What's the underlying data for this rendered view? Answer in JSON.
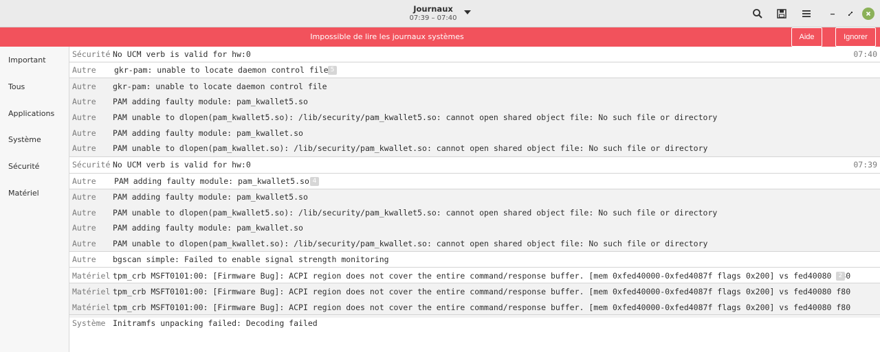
{
  "header": {
    "title": "Journaux",
    "subtitle": "07:39 – 07:40",
    "icons": [
      "search-icon",
      "save-icon",
      "menu-icon",
      "minimize-icon",
      "restore-icon",
      "close-icon"
    ]
  },
  "infobar": {
    "message": "Impossible de lire les journaux systèmes",
    "help_label": "Aide",
    "ignore_label": "Ignorer",
    "color": "#f2525c"
  },
  "sidebar": {
    "items": [
      {
        "label": "Important"
      },
      {
        "label": "Tous"
      },
      {
        "label": "Applications"
      },
      {
        "label": "Système"
      },
      {
        "label": "Sécurité"
      },
      {
        "label": "Matériel"
      }
    ]
  },
  "logs": [
    {
      "category": "Sécurité",
      "message": "No UCM verb is valid for hw:0",
      "time": "07:40"
    },
    {
      "category": "Autre",
      "message": "gkr-pam: unable to locate daemon control file",
      "count": "5"
    },
    {
      "category": "Autre",
      "message": "gkr-pam: unable to locate daemon control file"
    },
    {
      "category": "Autre",
      "message": "PAM adding faulty module: pam_kwallet5.so"
    },
    {
      "category": "Autre",
      "message": "PAM unable to dlopen(pam_kwallet5.so): /lib/security/pam_kwallet5.so: cannot open shared object file: No such file or directory"
    },
    {
      "category": "Autre",
      "message": "PAM adding faulty module: pam_kwallet.so"
    },
    {
      "category": "Autre",
      "message": "PAM unable to dlopen(pam_kwallet.so): /lib/security/pam_kwallet.so: cannot open shared object file: No such file or directory"
    },
    {
      "category": "Sécurité",
      "message": "No UCM verb is valid for hw:0",
      "time": "07:39"
    },
    {
      "category": "Autre",
      "message": "PAM adding faulty module: pam_kwallet5.so",
      "count": "4"
    },
    {
      "category": "Autre",
      "message": "PAM adding faulty module: pam_kwallet5.so"
    },
    {
      "category": "Autre",
      "message": "PAM unable to dlopen(pam_kwallet5.so): /lib/security/pam_kwallet5.so: cannot open shared object file: No such file or directory"
    },
    {
      "category": "Autre",
      "message": "PAM adding faulty module: pam_kwallet.so"
    },
    {
      "category": "Autre",
      "message": "PAM unable to dlopen(pam_kwallet.so): /lib/security/pam_kwallet.so: cannot open shared object file: No such file or directory"
    },
    {
      "category": "Autre",
      "message": "bgscan simple: Failed to enable signal strength monitoring"
    },
    {
      "category": "Matériel",
      "message": "tpm_crb MSFT0101:00: [Firmware Bug]: ACPI region does not cover the entire command/response buffer. [mem 0xfed40000-0xfed4087f flags 0x200] vs fed40080 f80",
      "count": "2"
    },
    {
      "category": "Matériel",
      "message": "tpm_crb MSFT0101:00: [Firmware Bug]: ACPI region does not cover the entire command/response buffer. [mem 0xfed40000-0xfed4087f flags 0x200] vs fed40080 f80"
    },
    {
      "category": "Matériel",
      "message": "tpm_crb MSFT0101:00: [Firmware Bug]: ACPI region does not cover the entire command/response buffer. [mem 0xfed40000-0xfed4087f flags 0x200] vs fed40080 f80"
    },
    {
      "category": "Système",
      "message": "Initramfs unpacking failed: Decoding failed"
    }
  ]
}
